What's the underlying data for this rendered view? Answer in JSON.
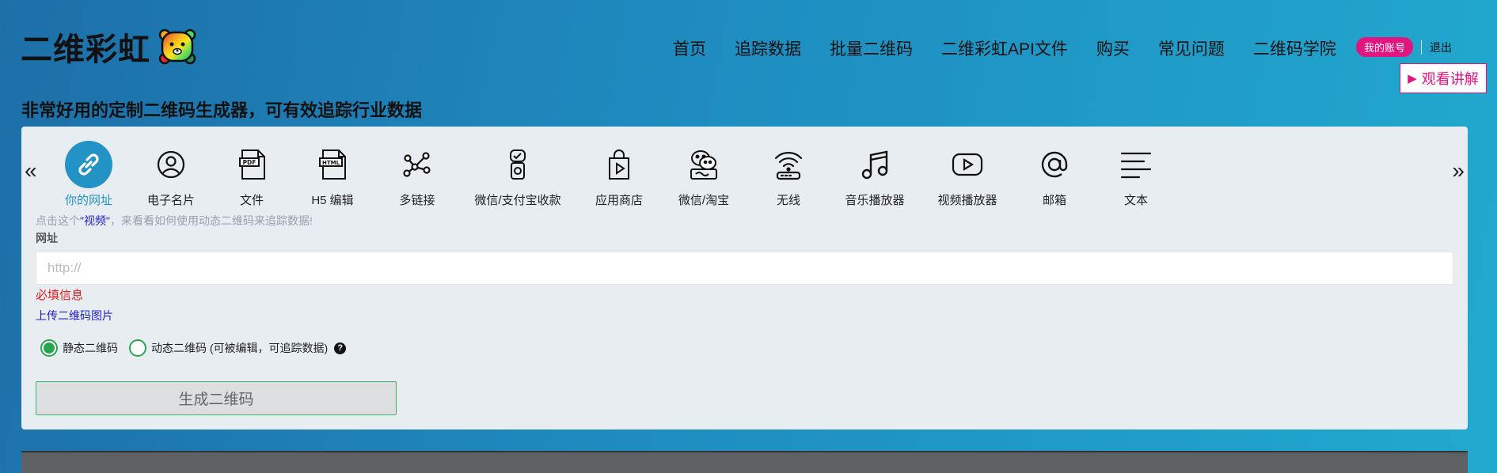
{
  "header": {
    "logo_text": "二维彩虹",
    "nav": [
      "首页",
      "追踪数据",
      "批量二维码",
      "二维彩虹API文件",
      "购买",
      "常见问题",
      "二维码学院"
    ],
    "account_label": "我的账号",
    "logout_label": "退出",
    "video_button_label": "观看讲解"
  },
  "tagline": "非常好用的定制二维码生成器，可有效追踪行业数据",
  "types": [
    {
      "label": "你的网址",
      "icon": "link-icon",
      "active": true
    },
    {
      "label": "电子名片",
      "icon": "user-icon",
      "active": false
    },
    {
      "label": "文件",
      "icon": "pdf-icon",
      "active": false
    },
    {
      "label": "H5 编辑",
      "icon": "html-icon",
      "active": false
    },
    {
      "label": "多链接",
      "icon": "multi-link-icon",
      "active": false
    },
    {
      "label": "微信/支付宝收款",
      "icon": "payment-icon",
      "active": false
    },
    {
      "label": "应用商店",
      "icon": "app-store-icon",
      "active": false
    },
    {
      "label": "微信/淘宝",
      "icon": "wechat-icon",
      "active": false
    },
    {
      "label": "无线",
      "icon": "wifi-icon",
      "active": false
    },
    {
      "label": "音乐播放器",
      "icon": "music-icon",
      "active": false
    },
    {
      "label": "视频播放器",
      "icon": "video-icon",
      "active": false
    },
    {
      "label": "邮箱",
      "icon": "email-icon",
      "active": false
    },
    {
      "label": "文本",
      "icon": "text-icon",
      "active": false
    }
  ],
  "hint": {
    "prefix": "点击这个",
    "link": "\"视频\"",
    "suffix": "，来看看如何使用动态二维码来追踪数据!"
  },
  "form": {
    "field_label": "网址",
    "url_placeholder": "http://",
    "url_value": "",
    "required_text": "必填信息",
    "upload_link": "上传二维码图片",
    "static_label": "静态二维码",
    "dynamic_label": "动态二维码 (可被编辑，可追踪数据)",
    "generate_label": "生成二维码"
  },
  "colors": {
    "accent": "#2293c4",
    "brand_pink": "#e0157f",
    "green": "#2aa54f",
    "error": "#e02020"
  }
}
